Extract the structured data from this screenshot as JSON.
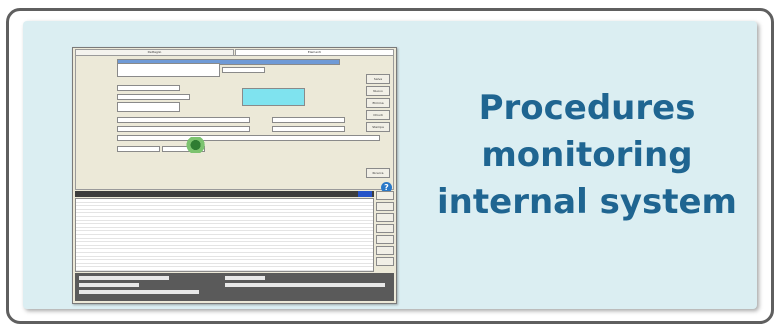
{
  "caption": {
    "line1": "Procedures",
    "line2": "monitoring",
    "line3": "internal system"
  },
  "colors": {
    "caption_text": "#1f6591",
    "card_background": "#dbeef2",
    "card_border": "#5f5f5f"
  },
  "screenshot": {
    "tabs": [
      "Dettaglio",
      "Elementi"
    ],
    "buttons": [
      "Salva",
      "Nuovo",
      "Elimina",
      "Chiudi",
      "Stampa",
      "Ricerca"
    ],
    "icons": [
      "help-icon"
    ]
  }
}
